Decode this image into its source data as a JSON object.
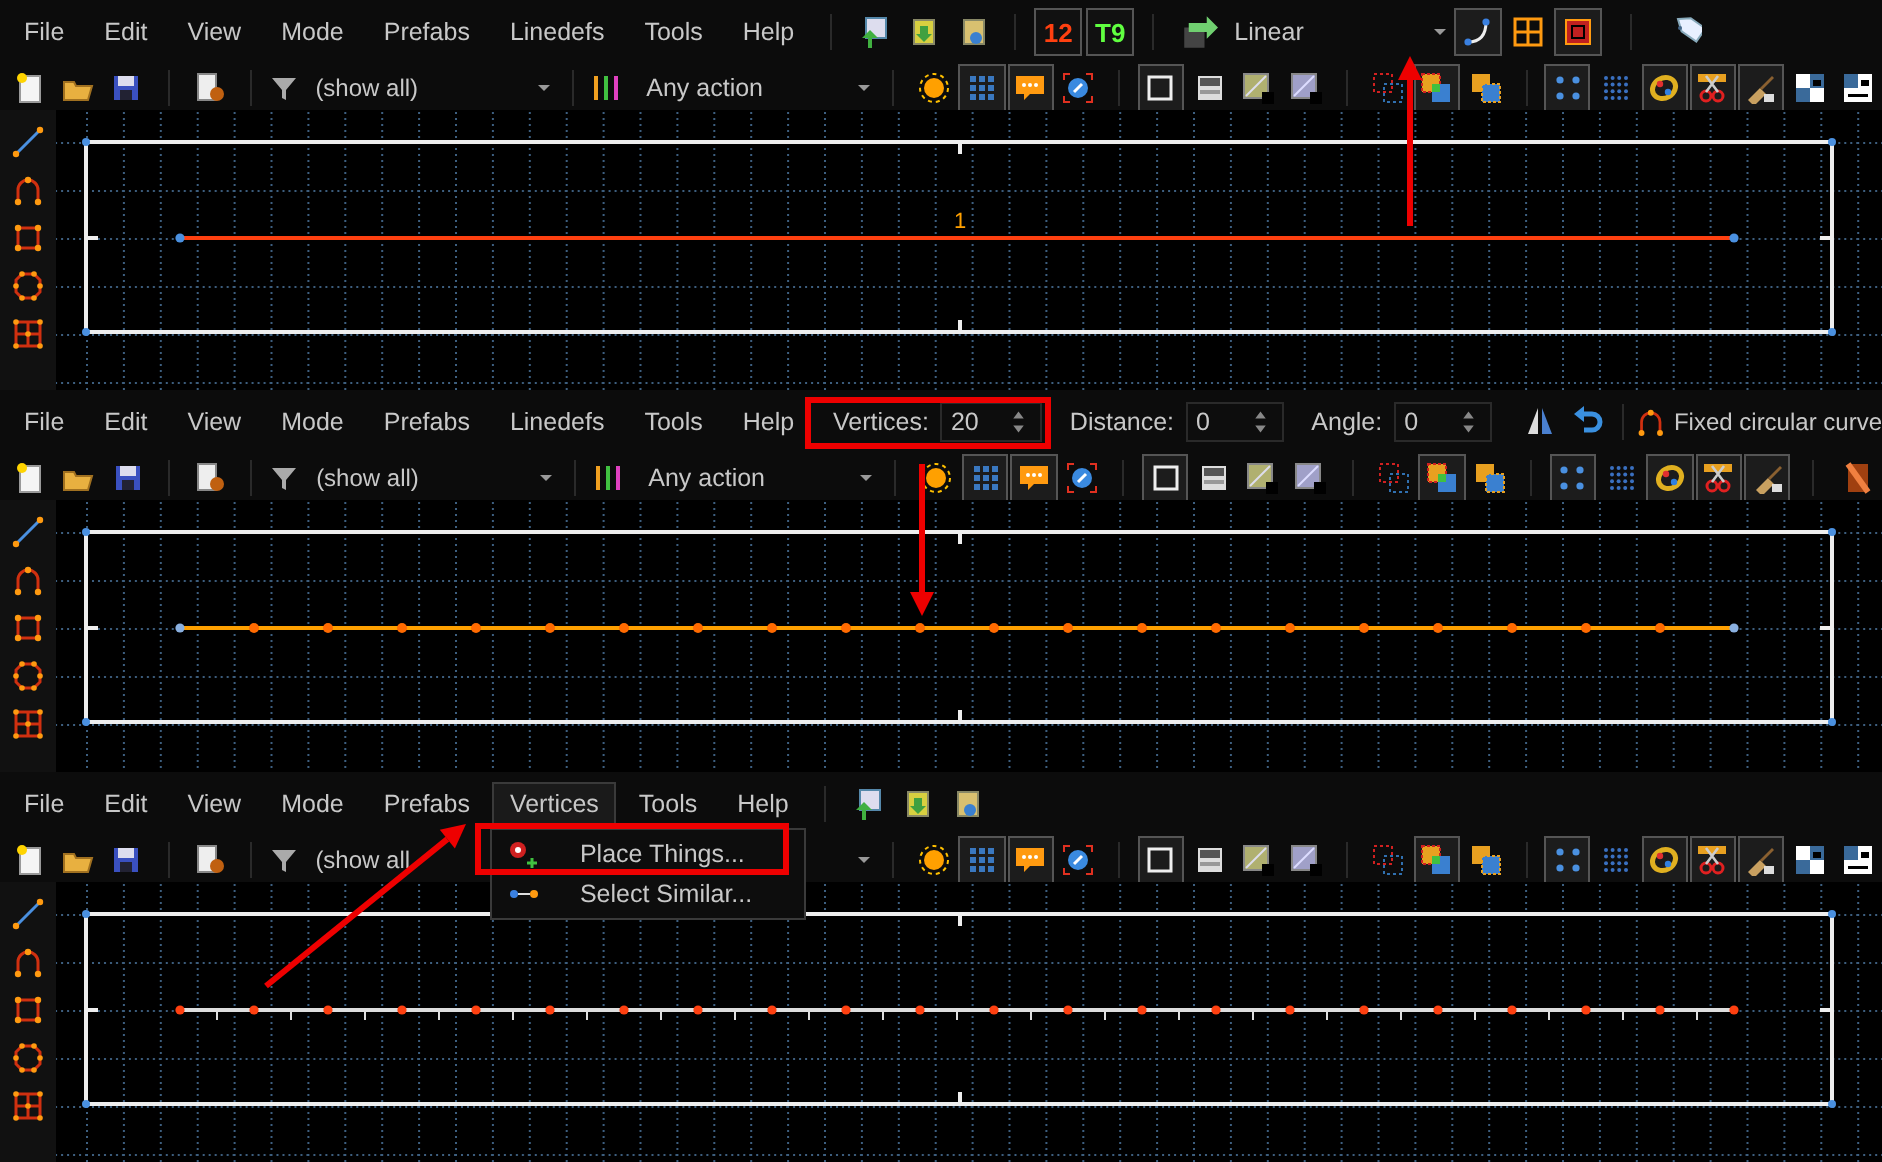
{
  "panels": [
    {
      "menu": [
        {
          "label": "File",
          "open": false
        },
        {
          "label": "Edit",
          "open": false
        },
        {
          "label": "View",
          "open": false
        },
        {
          "label": "Mode",
          "open": false
        },
        {
          "label": "Prefabs",
          "open": false
        },
        {
          "label": "Linedefs",
          "open": false
        },
        {
          "label": "Tools",
          "open": false
        },
        {
          "label": "Help",
          "open": false
        }
      ],
      "top": {
        "kind": "curve-tools",
        "counters": [
          "12",
          "T9"
        ],
        "interpolation": "Linear",
        "pressed": [
          true,
          false,
          true
        ]
      },
      "filter": "(show all)",
      "action": "Any action",
      "kind": "locks",
      "pressed": [
        false,
        true,
        true,
        false,
        true,
        false,
        false,
        false,
        false,
        true,
        false,
        true,
        false,
        true,
        true,
        true,
        false,
        false
      ],
      "map": {
        "kind": "single-line",
        "label": "1"
      }
    },
    {
      "menu": [
        {
          "label": "File",
          "open": false
        },
        {
          "label": "Edit",
          "open": false
        },
        {
          "label": "View",
          "open": false
        },
        {
          "label": "Mode",
          "open": false
        },
        {
          "label": "Prefabs",
          "open": false
        },
        {
          "label": "Linedefs",
          "open": false
        },
        {
          "label": "Tools",
          "open": false
        },
        {
          "label": "Help",
          "open": false
        }
      ],
      "top": {
        "kind": "curve-settings",
        "fields": [
          {
            "label": "Vertices:",
            "value": "20"
          },
          {
            "label": "Distance:",
            "value": "0"
          },
          {
            "label": "Angle:",
            "value": "0"
          }
        ],
        "preset": "Fixed circular curve"
      },
      "filter": "(show all)",
      "action": "Any action",
      "kind": "door",
      "pressed": [
        false,
        true,
        true,
        false,
        true,
        false,
        false,
        false,
        false,
        true,
        false,
        true,
        false,
        true,
        true,
        true,
        false
      ],
      "map": {
        "kind": "split-line"
      }
    },
    {
      "menu": [
        {
          "label": "File",
          "open": false
        },
        {
          "label": "Edit",
          "open": false
        },
        {
          "label": "View",
          "open": false
        },
        {
          "label": "Mode",
          "open": false
        },
        {
          "label": "Prefabs",
          "open": false
        },
        {
          "label": "Vertices",
          "open": true
        },
        {
          "label": "Tools",
          "open": false
        },
        {
          "label": "Help",
          "open": false
        }
      ],
      "dropdown": [
        {
          "label": "Place Things..."
        },
        {
          "label": "Select Similar..."
        }
      ],
      "top": {
        "kind": "prefab-tools"
      },
      "filter": "(show all",
      "kind": "locks",
      "pressed": [
        false,
        true,
        true,
        false,
        true,
        false,
        false,
        false,
        false,
        true,
        false,
        true,
        false,
        true,
        true,
        true,
        false,
        false
      ],
      "map": {
        "kind": "split-points"
      }
    }
  ]
}
